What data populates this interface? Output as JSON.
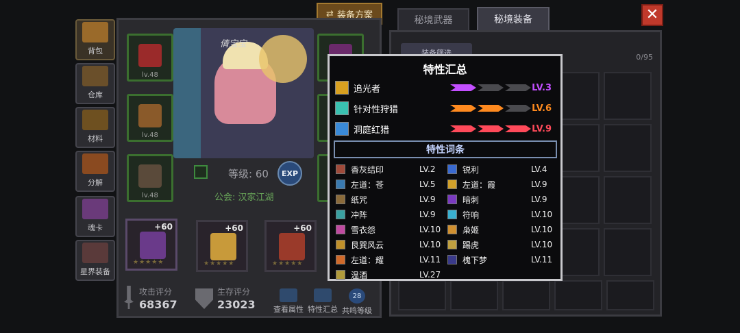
{
  "header": {
    "plan_button": "装备方案",
    "tabs": [
      "秘境武器",
      "秘境装备"
    ],
    "close_icon": "close-icon"
  },
  "sidebar": {
    "items": [
      {
        "label": "背包"
      },
      {
        "label": "仓库"
      },
      {
        "label": "材料"
      },
      {
        "label": "分解"
      },
      {
        "label": "魂卡"
      },
      {
        "label": "星界装备"
      }
    ]
  },
  "character": {
    "name": "倩宝宝",
    "level_text": "等级: 60",
    "exp_label": "EXP",
    "guild_text": "公会: 汉家江湖",
    "slot_levels": [
      "lv.48",
      "lv.48",
      "lv.48"
    ],
    "bottom_slots": [
      "+60",
      "+60",
      "+60"
    ],
    "attack_label": "攻击评分",
    "attack_value": "68367",
    "survive_label": "生存评分",
    "survive_value": "23023",
    "actions": [
      "查看属性",
      "特性汇总",
      "共鸣等级"
    ],
    "resonance_badge": "28"
  },
  "inventory": {
    "filter_label": "装备筛选",
    "count": "0/95"
  },
  "popup": {
    "title": "特性汇总",
    "traits": [
      {
        "name": "追光者",
        "level": "LV.3",
        "color": "#c34fff",
        "filled": 1
      },
      {
        "name": "针对性狩猎",
        "level": "LV.6",
        "color": "#ff8a1f",
        "filled": 2
      },
      {
        "name": "洞庭红猎",
        "level": "LV.9",
        "color": "#ff4a5a",
        "filled": 3
      }
    ],
    "subheader": "特性词条",
    "entries_left": [
      {
        "name": "香灰结印",
        "level": "LV.2"
      },
      {
        "name": "左道：苍",
        "level": "LV.5"
      },
      {
        "name": "纸咒",
        "level": "LV.9"
      },
      {
        "name": "冲阵",
        "level": "LV.9"
      },
      {
        "name": "雪衣怨",
        "level": "LV.10"
      },
      {
        "name": "艮巽风云",
        "level": "LV.10"
      },
      {
        "name": "左道：耀",
        "level": "LV.11"
      },
      {
        "name": "温酒",
        "level": "LV.27"
      }
    ],
    "entries_right": [
      {
        "name": "锐利",
        "level": "LV.4"
      },
      {
        "name": "左道：霞",
        "level": "LV.9"
      },
      {
        "name": "暗刺",
        "level": "LV.9"
      },
      {
        "name": "符响",
        "level": "LV.10"
      },
      {
        "name": "枭姬",
        "level": "LV.10"
      },
      {
        "name": "踢虎",
        "level": "LV.10"
      },
      {
        "name": "槐下梦",
        "level": "LV.11"
      }
    ]
  }
}
